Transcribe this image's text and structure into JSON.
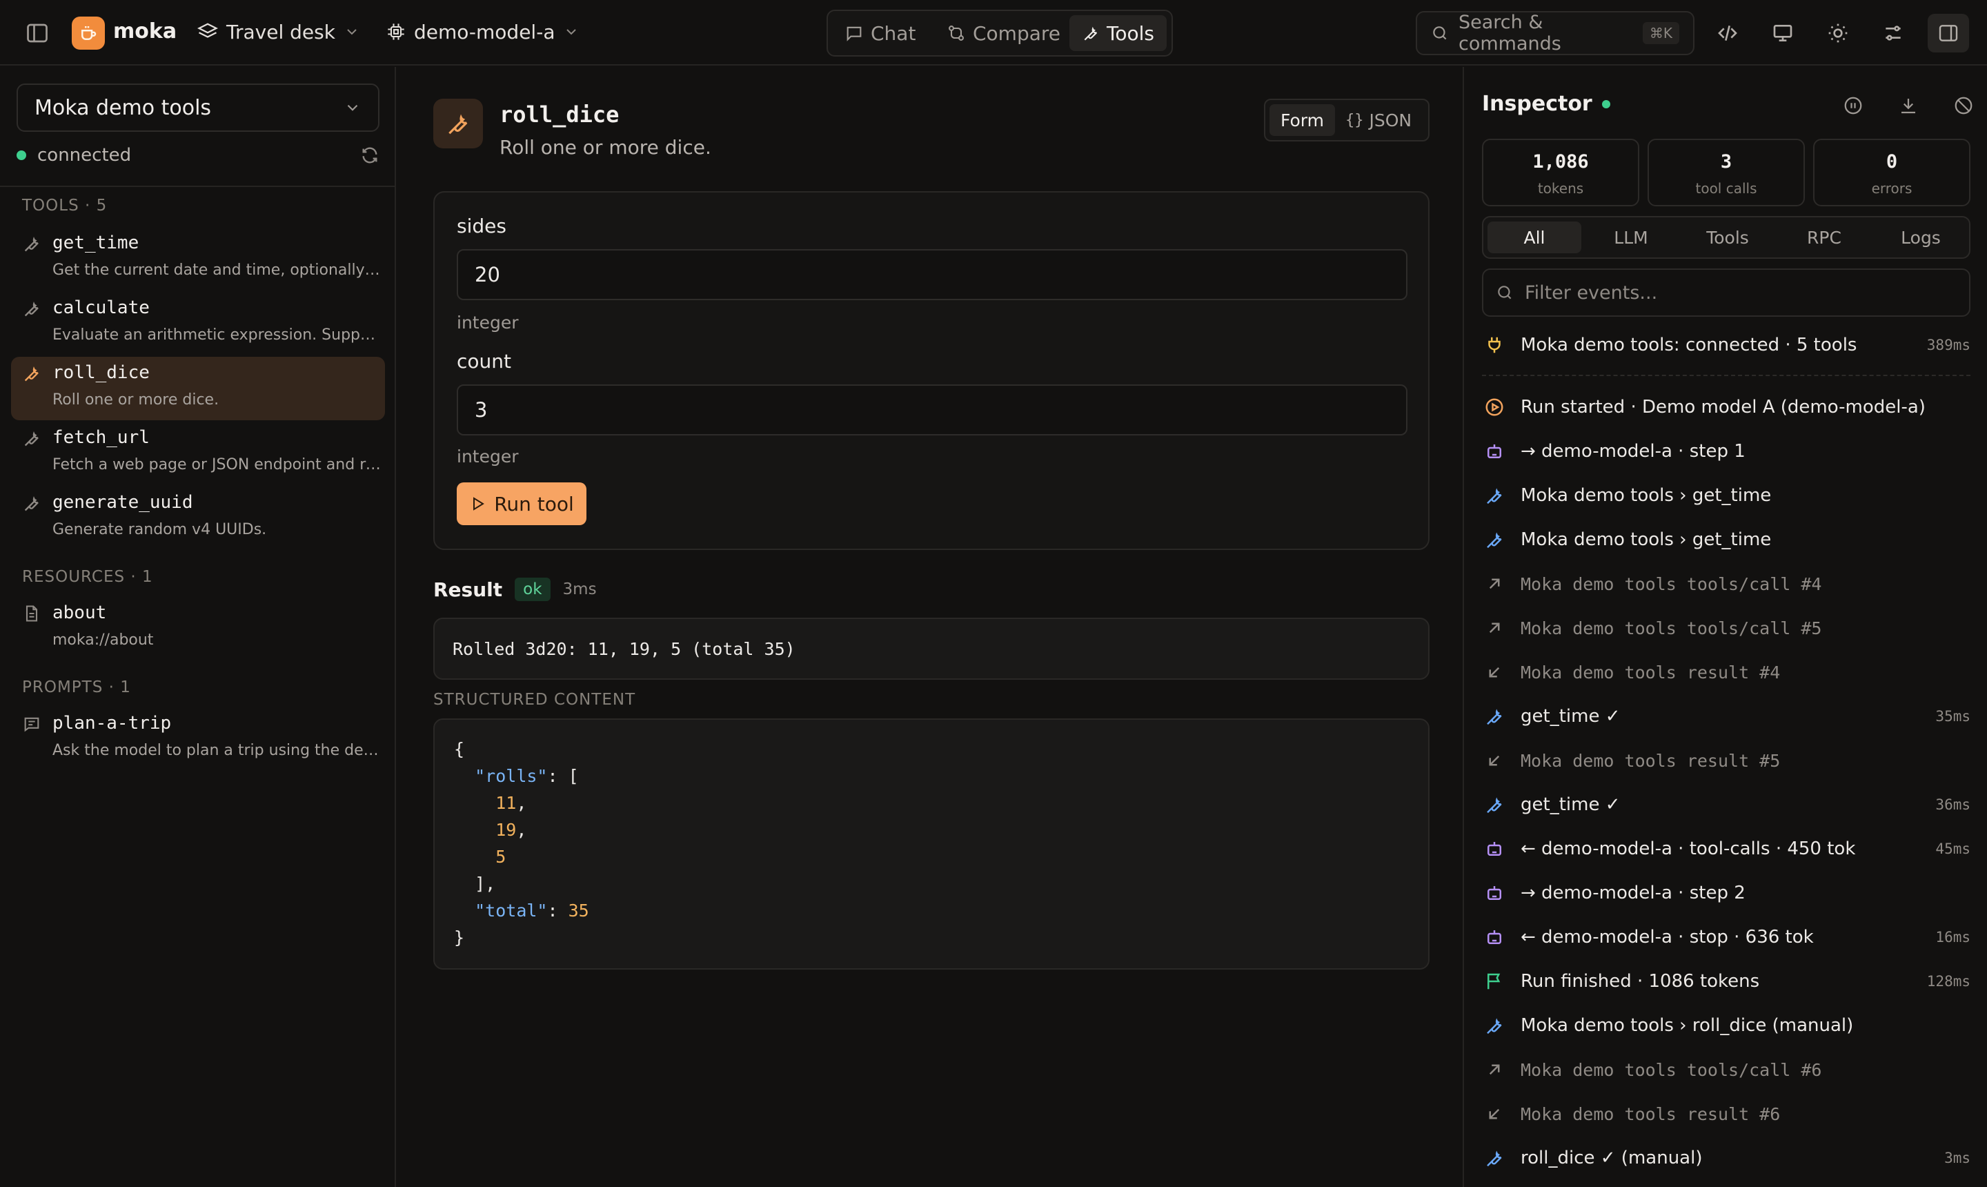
{
  "app": {
    "brand": "moka",
    "workspace": "Travel desk",
    "model": "demo-model-a",
    "nav_tabs": [
      {
        "label": "Chat"
      },
      {
        "label": "Compare"
      },
      {
        "label": "Tools"
      }
    ],
    "active_tab": "Tools",
    "search_placeholder": "Search & commands",
    "search_shortcut": "⌘K"
  },
  "sidebar": {
    "server_name": "Moka demo tools",
    "status": "connected",
    "tools_header": "TOOLS · 5",
    "tools": [
      {
        "name": "get_time",
        "desc": "Get the current date and time, optionally in a given timezone."
      },
      {
        "name": "calculate",
        "desc": "Evaluate an arithmetic expression. Supports + - * / and parentheses."
      },
      {
        "name": "roll_dice",
        "desc": "Roll one or more dice."
      },
      {
        "name": "fetch_url",
        "desc": "Fetch a web page or JSON endpoint and return its contents."
      },
      {
        "name": "generate_uuid",
        "desc": "Generate random v4 UUIDs."
      }
    ],
    "resources_header": "RESOURCES · 1",
    "resources": [
      {
        "name": "about",
        "desc": "moka://about"
      }
    ],
    "prompts_header": "PROMPTS · 1",
    "prompts": [
      {
        "name": "plan-a-trip",
        "desc": "Ask the model to plan a trip using the demo tools."
      }
    ]
  },
  "main": {
    "tool_name": "roll_dice",
    "tool_desc": "Roll one or more dice.",
    "mode_form": "Form",
    "mode_json": "JSON",
    "mode_json_glyph": "{}",
    "fields": [
      {
        "label": "sides",
        "value": "20",
        "type": "integer"
      },
      {
        "label": "count",
        "value": "3",
        "type": "integer"
      }
    ],
    "run_label": "Run tool",
    "result_label": "Result",
    "result_status": "ok",
    "result_time": "3ms",
    "result_text": "Rolled 3d20: 11, 19, 5 (total 35)",
    "structured_label": "STRUCTURED CONTENT",
    "structured": {
      "open": "{",
      "rolls_key": "\"rolls\"",
      "rolls_open": ": [",
      "rolls": [
        "11",
        "19",
        "5"
      ],
      "rolls_close": "],",
      "total_key": "\"total\"",
      "total_value": "35",
      "close": "}"
    }
  },
  "inspector": {
    "title": "Inspector",
    "stats": [
      {
        "value": "1,086",
        "label": "tokens"
      },
      {
        "value": "3",
        "label": "tool calls"
      },
      {
        "value": "0",
        "label": "errors"
      }
    ],
    "filters": [
      "All",
      "LLM",
      "Tools",
      "RPC",
      "Logs"
    ],
    "active_filter": "All",
    "filter_placeholder": "Filter events...",
    "events": [
      {
        "icon": "plug-icon",
        "kind": "plain",
        "text": "Moka demo tools: connected · 5 tools",
        "dur": "389ms"
      },
      {
        "icon": "play-icon",
        "kind": "plain",
        "text": "Run started · Demo model A (demo-model-a)",
        "dur": ""
      },
      {
        "icon": "bot-icon",
        "kind": "plain",
        "text": "→ demo-model-a · step 1",
        "dur": ""
      },
      {
        "icon": "wrench-icon",
        "kind": "plain",
        "text": "Moka demo tools › get_time",
        "dur": ""
      },
      {
        "icon": "wrench-icon",
        "kind": "plain",
        "text": "Moka demo tools › get_time",
        "dur": ""
      },
      {
        "icon": "arrow-out-icon",
        "kind": "muted",
        "text": "Moka demo tools tools/call #4",
        "dur": ""
      },
      {
        "icon": "arrow-out-icon",
        "kind": "muted",
        "text": "Moka demo tools tools/call #5",
        "dur": ""
      },
      {
        "icon": "arrow-in-icon",
        "kind": "muted",
        "text": "Moka demo tools result #4",
        "dur": ""
      },
      {
        "icon": "wrench-icon",
        "kind": "plain",
        "text": "get_time ✓",
        "dur": "35ms"
      },
      {
        "icon": "arrow-in-icon",
        "kind": "muted",
        "text": "Moka demo tools result #5",
        "dur": ""
      },
      {
        "icon": "wrench-icon",
        "kind": "plain",
        "text": "get_time ✓",
        "dur": "36ms"
      },
      {
        "icon": "bot-icon",
        "kind": "plain",
        "text": "← demo-model-a · tool-calls · 450 tok",
        "dur": "45ms"
      },
      {
        "icon": "bot-icon",
        "kind": "plain",
        "text": "→ demo-model-a · step 2",
        "dur": ""
      },
      {
        "icon": "bot-icon",
        "kind": "plain",
        "text": "← demo-model-a · stop · 636 tok",
        "dur": "16ms"
      },
      {
        "icon": "flag-icon",
        "kind": "plain",
        "text": "Run finished · 1086 tokens",
        "dur": "128ms"
      },
      {
        "icon": "wrench-icon",
        "kind": "plain",
        "text": "Moka demo tools › roll_dice (manual)",
        "dur": ""
      },
      {
        "icon": "arrow-out-icon",
        "kind": "muted",
        "text": "Moka demo tools tools/call #6",
        "dur": ""
      },
      {
        "icon": "arrow-in-icon",
        "kind": "muted",
        "text": "Moka demo tools result #6",
        "dur": ""
      },
      {
        "icon": "wrench-icon",
        "kind": "plain",
        "text": "roll_dice ✓ (manual)",
        "dur": "3ms"
      }
    ]
  },
  "colors": {
    "accent": "#f7a463",
    "status_ok": "#3ecf8e",
    "background": "#121110"
  }
}
